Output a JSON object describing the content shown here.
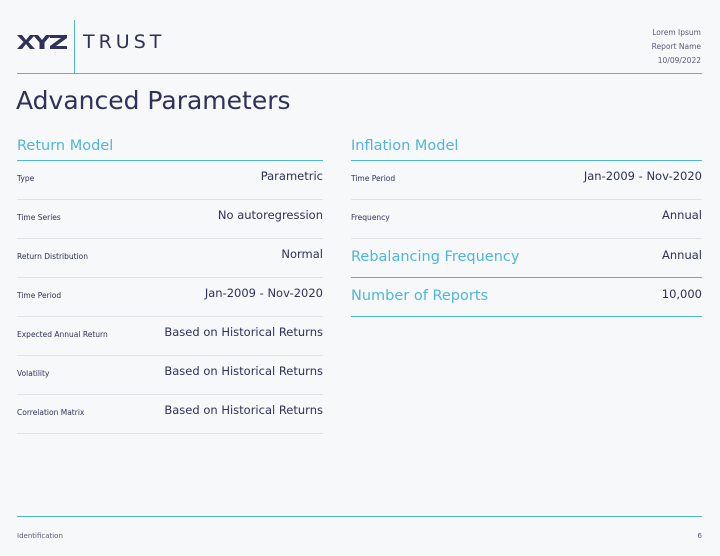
{
  "header": {
    "logo_mark": "XYZ",
    "logo_text": "TRUST",
    "meta": [
      "Lorem Ipsum",
      "Report Name",
      "10/09/2022"
    ]
  },
  "title": "Advanced Parameters",
  "return_model": {
    "heading": "Return Model",
    "rows": [
      {
        "label": "Type",
        "value": "Parametric"
      },
      {
        "label": "Time Series",
        "value": "No autoregression"
      },
      {
        "label": "Return Distribution",
        "value": "Normal"
      },
      {
        "label": "Time Period",
        "value": "Jan-2009 - Nov-2020"
      },
      {
        "label": "Expected Annual Return",
        "value": "Based on Historical Returns"
      },
      {
        "label": "Volatility",
        "value": "Based on Historical Returns"
      },
      {
        "label": "Correlation Matrix",
        "value": "Based on Historical Returns"
      }
    ]
  },
  "inflation_model": {
    "heading": "Inflation Model",
    "rows": [
      {
        "label": "Time Period",
        "value": "Jan-2009 - Nov-2020"
      },
      {
        "label": "Frequency",
        "value": "Annual"
      }
    ]
  },
  "rebalancing": {
    "label": "Rebalancing Frequency",
    "value": "Annual"
  },
  "reports": {
    "label": "Number of Reports",
    "value": "10,000"
  },
  "footer": {
    "left": "Identification",
    "page": "6"
  },
  "colors": {
    "accent": "#4fb6d8",
    "text": "#2e3158",
    "background": "#f6f8fa"
  }
}
